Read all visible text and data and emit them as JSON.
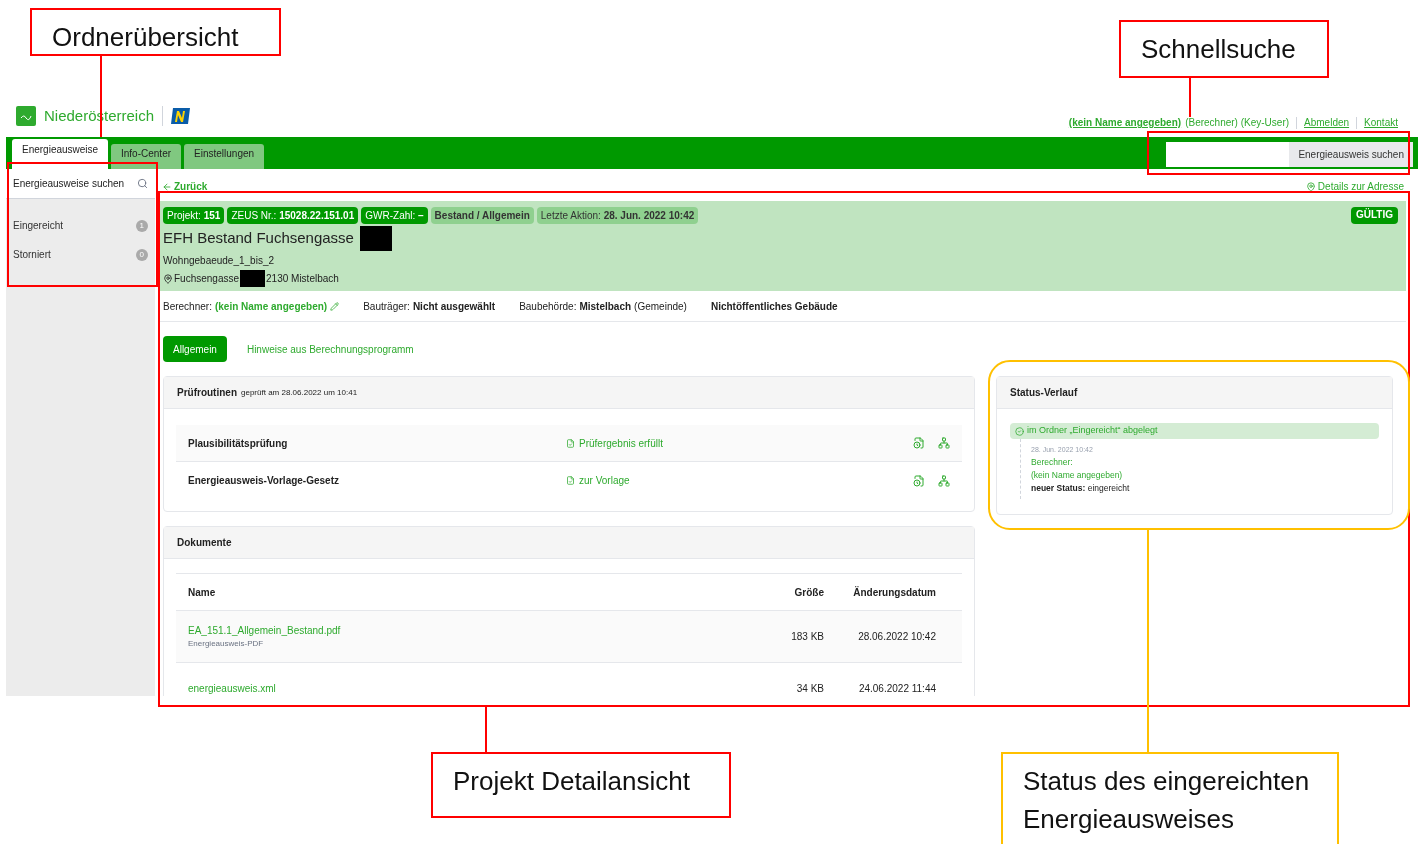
{
  "logo": {
    "text": "Niederösterreich"
  },
  "user": {
    "name": "(kein Name angegeben)",
    "role": "(Berechner) (Key-User)"
  },
  "header_links": [
    "Abmelden",
    "Kontakt"
  ],
  "tabs": [
    {
      "label": "Energieausweise",
      "selected": true
    },
    {
      "label": "Info-Center",
      "selected": false
    },
    {
      "label": "Einstellungen",
      "selected": false
    }
  ],
  "quick_search": {
    "button": "Energieausweis suchen"
  },
  "sidebar": {
    "search_placeholder": "Energieausweise suchen",
    "folders": [
      {
        "label": "Eingereicht",
        "count": "1"
      },
      {
        "label": "Storniert",
        "count": "0"
      }
    ]
  },
  "back_link": "Zurück",
  "address_link": "Details zur Adresse",
  "project": {
    "badges": [
      {
        "label": "Projekt:",
        "value": "151",
        "kind": "dark"
      },
      {
        "label": "ZEUS Nr.:",
        "value": "15028.22.151.01",
        "kind": "dark"
      },
      {
        "label": "GWR-Zahl:",
        "value": "–",
        "kind": "dark"
      },
      {
        "value": "Bestand / Allgemein",
        "kind": "light"
      },
      {
        "label": "Letzte Aktion:",
        "value": "28. Jun. 2022 10:42",
        "kind": "light"
      }
    ],
    "status": "GÜLTIG",
    "title": "EFH Bestand Fuchsengasse",
    "subtitle": "Wohngebaeude_1_bis_2",
    "address_street": "Fuchsengasse",
    "address_city": "2130 Mistelbach"
  },
  "facts": [
    {
      "label": "Berechner:",
      "value": "(kein Name angegeben)",
      "kind": "editable"
    },
    {
      "label": "Bauträger:",
      "value": "Nicht ausgewählt",
      "kind": "plain"
    },
    {
      "label": "Baubehörde:",
      "value": "Mistelbach",
      "note": "(Gemeinde)",
      "kind": "plain"
    },
    {
      "value": "Nichtöffentliches Gebäude",
      "kind": "plain"
    }
  ],
  "detail_tabs": [
    {
      "label": "Allgemein",
      "selected": true
    },
    {
      "label": "Hinweise aus Berechnungsprogramm",
      "selected": false
    }
  ],
  "checks": {
    "title": "Prüfroutinen",
    "note": "geprüft am 28.06.2022 um 10:41",
    "rows": [
      {
        "name": "Plausibilitätsprüfung",
        "result": "Prüfergebnis erfüllt"
      },
      {
        "name": "Energieausweis-Vorlage-Gesetz",
        "result": "zur Vorlage"
      }
    ]
  },
  "documents": {
    "title": "Dokumente",
    "columns": [
      "Name",
      "Größe",
      "Änderungsdatum"
    ],
    "rows": [
      {
        "name": "EA_151.1_Allgemein_Bestand.pdf",
        "type": "Energieausweis-PDF",
        "size": "183 KB",
        "date": "28.06.2022 10:42"
      },
      {
        "name": "energieausweis.xml",
        "size": "34 KB",
        "date": "24.06.2022 11:44"
      }
    ]
  },
  "status_history": {
    "title": "Status-Verlauf",
    "event": "im Ordner „Eingereicht“ abgelegt",
    "date": "28. Jun. 2022 10:42",
    "by_label": "Berechner:",
    "by": "(kein Name angegeben)",
    "new_status_label": "neuer Status:",
    "new_status": "eingereicht"
  },
  "annotations": [
    {
      "label": "Ordnerübersicht",
      "color": "#ff0000"
    },
    {
      "label": "Schnellsuche",
      "color": "#ff0000"
    },
    {
      "label": "Projekt Detailansicht",
      "color": "#ff0000"
    },
    {
      "label": "Status des eingereichten Energieausweises",
      "color": "#ffc000"
    }
  ]
}
